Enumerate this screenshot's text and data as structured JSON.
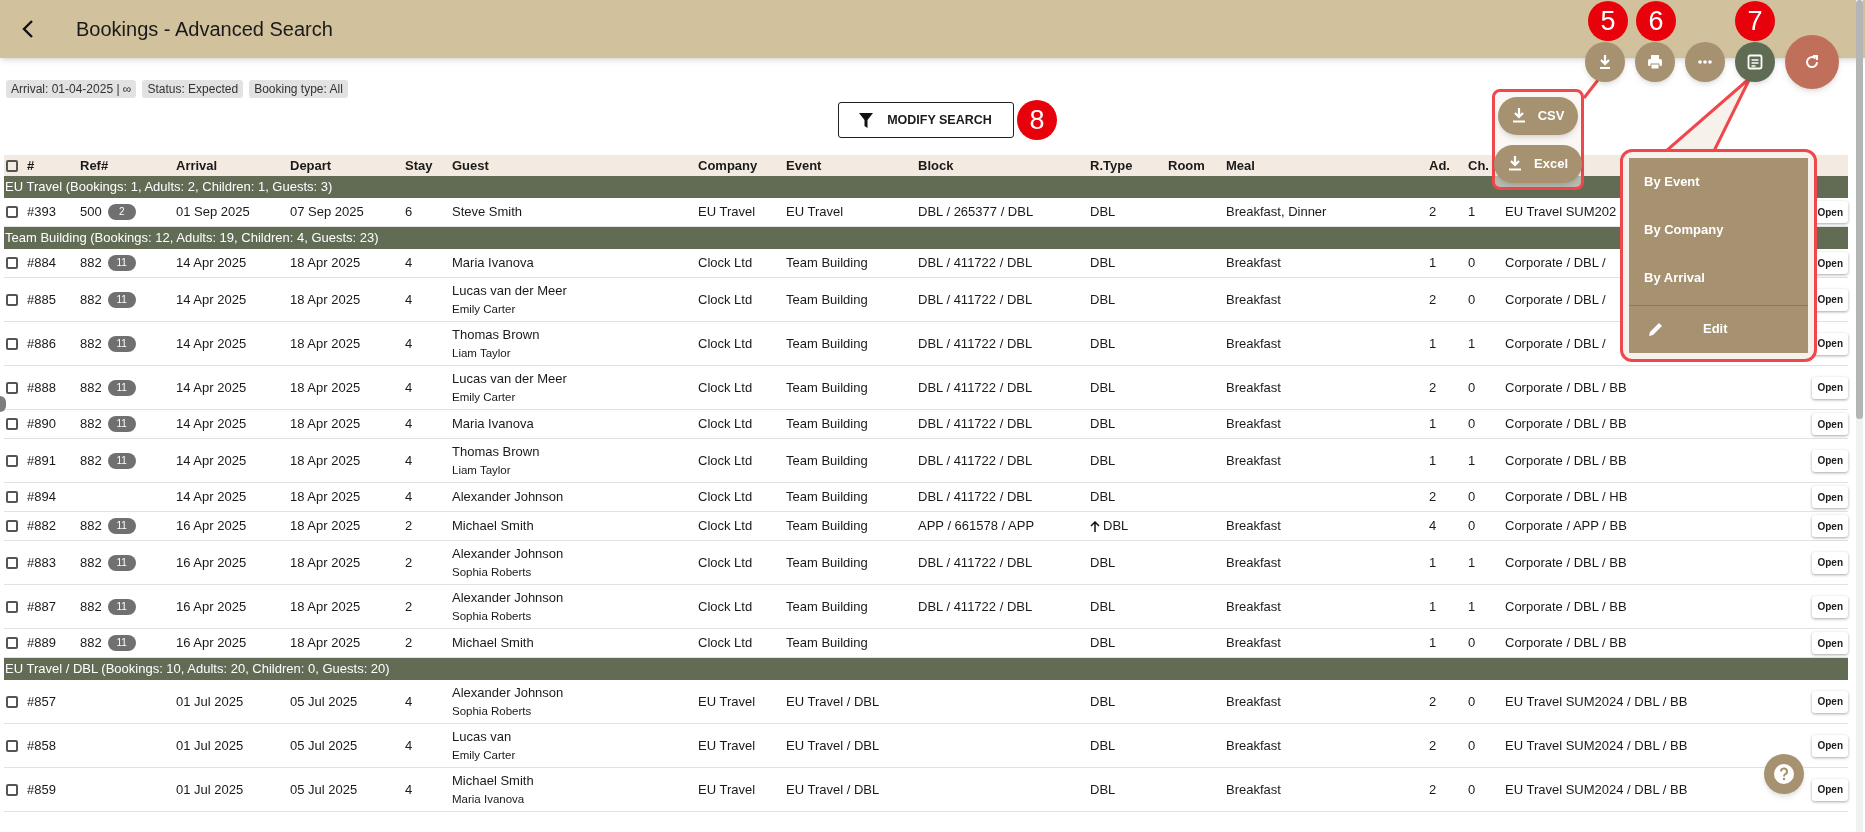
{
  "header": {
    "title": "Bookings - Advanced Search"
  },
  "filters": [
    "Arrival: 01-04-2025 | ∞",
    "Status: Expected",
    "Booking type: All"
  ],
  "modify_search": "MODIFY SEARCH",
  "annotations": [
    "5",
    "6",
    "7",
    "8"
  ],
  "export_menu": [
    "CSV",
    "Excel"
  ],
  "view_menu": {
    "items": [
      "By Event",
      "By Company",
      "By Arrival"
    ],
    "edit": "Edit"
  },
  "table": {
    "select_all_checked": false,
    "columns": [
      "#",
      "Ref#",
      "Arrival",
      "Depart",
      "Stay",
      "Guest",
      "Company",
      "Event",
      "Block",
      "R.Type",
      "Room",
      "Meal",
      "Ad.",
      "Ch."
    ],
    "rows": [
      {
        "kind": "group",
        "text": "EU Travel (Bookings: 1, Adults: 2, Children: 1, Guests: 3)"
      },
      {
        "kind": "booking",
        "checked": false,
        "number": "#393",
        "ref": "500",
        "ref_count": "2",
        "arrival": "01 Sep 2025",
        "depart": "07 Sep 2025",
        "stay": "6",
        "guest": "Steve Smith",
        "company": "EU Travel",
        "event": "EU Travel",
        "block": "DBL / 265377 / DBL",
        "rtype": "DBL",
        "upgraded": false,
        "meal": "Breakfast, Dinner",
        "adults": "2",
        "children": "1",
        "package": "EU Travel SUM202",
        "open": "Open"
      },
      {
        "kind": "group",
        "text": "Team Building (Bookings: 12, Adults: 19, Children: 4, Guests: 23)"
      },
      {
        "kind": "booking",
        "checked": false,
        "number": "#884",
        "ref": "882",
        "ref_count": "11",
        "arrival": "14 Apr 2025",
        "depart": "18 Apr 2025",
        "stay": "4",
        "guest": "Maria Ivanova",
        "company": "Clock Ltd",
        "event": "Team Building",
        "block": "DBL / 411722 / DBL",
        "rtype": "DBL",
        "upgraded": false,
        "meal": "Breakfast",
        "adults": "1",
        "children": "0",
        "package": "Corporate / DBL /",
        "open": "Open"
      },
      {
        "kind": "booking",
        "checked": false,
        "number": "#885",
        "ref": "882",
        "ref_count": "11",
        "arrival": "14 Apr 2025",
        "depart": "18 Apr 2025",
        "stay": "4",
        "guest": "Lucas van der Meer",
        "guest_2": "Emily Carter",
        "company": "Clock Ltd",
        "event": "Team Building",
        "block": "DBL / 411722 / DBL",
        "rtype": "DBL",
        "upgraded": false,
        "meal": "Breakfast",
        "adults": "2",
        "children": "0",
        "package": "Corporate / DBL /",
        "open": "Open"
      },
      {
        "kind": "booking",
        "checked": false,
        "number": "#886",
        "ref": "882",
        "ref_count": "11",
        "arrival": "14 Apr 2025",
        "depart": "18 Apr 2025",
        "stay": "4",
        "guest": "Thomas Brown",
        "guest_2": "Liam Taylor",
        "company": "Clock Ltd",
        "event": "Team Building",
        "block": "DBL / 411722 / DBL",
        "rtype": "DBL",
        "upgraded": false,
        "meal": "Breakfast",
        "adults": "1",
        "children": "1",
        "package": "Corporate / DBL /",
        "open": "Open"
      },
      {
        "kind": "booking",
        "checked": false,
        "number": "#888",
        "ref": "882",
        "ref_count": "11",
        "arrival": "14 Apr 2025",
        "depart": "18 Apr 2025",
        "stay": "4",
        "guest": "Lucas van der Meer",
        "guest_2": "Emily Carter",
        "company": "Clock Ltd",
        "event": "Team Building",
        "block": "DBL / 411722 / DBL",
        "rtype": "DBL",
        "upgraded": false,
        "meal": "Breakfast",
        "adults": "2",
        "children": "0",
        "package": "Corporate / DBL / BB",
        "open": "Open"
      },
      {
        "kind": "booking",
        "checked": false,
        "number": "#890",
        "ref": "882",
        "ref_count": "11",
        "arrival": "14 Apr 2025",
        "depart": "18 Apr 2025",
        "stay": "4",
        "guest": "Maria Ivanova",
        "company": "Clock Ltd",
        "event": "Team Building",
        "block": "DBL / 411722 / DBL",
        "rtype": "DBL",
        "upgraded": false,
        "meal": "Breakfast",
        "adults": "1",
        "children": "0",
        "package": "Corporate / DBL / BB",
        "open": "Open"
      },
      {
        "kind": "booking",
        "checked": false,
        "number": "#891",
        "ref": "882",
        "ref_count": "11",
        "arrival": "14 Apr 2025",
        "depart": "18 Apr 2025",
        "stay": "4",
        "guest": "Thomas Brown",
        "guest_2": "Liam Taylor",
        "company": "Clock Ltd",
        "event": "Team Building",
        "block": "DBL / 411722 / DBL",
        "rtype": "DBL",
        "upgraded": false,
        "meal": "Breakfast",
        "adults": "1",
        "children": "1",
        "package": "Corporate / DBL / BB",
        "open": "Open"
      },
      {
        "kind": "booking",
        "checked": false,
        "number": "#894",
        "arrival": "14 Apr 2025",
        "depart": "18 Apr 2025",
        "stay": "4",
        "guest": "Alexander Johnson",
        "company": "Clock Ltd",
        "event": "Team Building",
        "block": "DBL / 411722 / DBL",
        "rtype": "DBL",
        "upgraded": false,
        "adults": "2",
        "children": "0",
        "package": "Corporate / DBL / HB",
        "open": "Open"
      },
      {
        "kind": "booking",
        "checked": false,
        "number": "#882",
        "ref": "882",
        "ref_count": "11",
        "arrival": "16 Apr 2025",
        "depart": "18 Apr 2025",
        "stay": "2",
        "guest": "Michael Smith",
        "company": "Clock Ltd",
        "event": "Team Building",
        "block": "APP / 661578 / APP",
        "rtype": "DBL",
        "upgraded": true,
        "meal": "Breakfast",
        "adults": "4",
        "children": "0",
        "package": "Corporate / APP / BB",
        "open": "Open"
      },
      {
        "kind": "booking",
        "checked": false,
        "number": "#883",
        "ref": "882",
        "ref_count": "11",
        "arrival": "16 Apr 2025",
        "depart": "18 Apr 2025",
        "stay": "2",
        "guest": "Alexander Johnson",
        "guest_2": "Sophia Roberts",
        "company": "Clock Ltd",
        "event": "Team Building",
        "block": "DBL / 411722 / DBL",
        "rtype": "DBL",
        "upgraded": false,
        "meal": "Breakfast",
        "adults": "1",
        "children": "1",
        "package": "Corporate / DBL / BB",
        "open": "Open"
      },
      {
        "kind": "booking",
        "checked": false,
        "number": "#887",
        "ref": "882",
        "ref_count": "11",
        "arrival": "16 Apr 2025",
        "depart": "18 Apr 2025",
        "stay": "2",
        "guest": "Alexander Johnson",
        "guest_2": "Sophia Roberts",
        "company": "Clock Ltd",
        "event": "Team Building",
        "block": "DBL / 411722 / DBL",
        "rtype": "DBL",
        "upgraded": false,
        "meal": "Breakfast",
        "adults": "1",
        "children": "1",
        "package": "Corporate / DBL / BB",
        "open": "Open"
      },
      {
        "kind": "booking",
        "checked": false,
        "number": "#889",
        "ref": "882",
        "ref_count": "11",
        "arrival": "16 Apr 2025",
        "depart": "18 Apr 2025",
        "stay": "2",
        "guest": "Michael Smith",
        "company": "Clock Ltd",
        "event": "Team Building",
        "rtype": "DBL",
        "upgraded": false,
        "meal": "Breakfast",
        "adults": "1",
        "children": "0",
        "package": "Corporate / DBL / BB",
        "open": "Open"
      },
      {
        "kind": "group",
        "text": "EU Travel / DBL (Bookings: 10, Adults: 20, Children: 0, Guests: 20)"
      },
      {
        "kind": "booking",
        "checked": false,
        "number": "#857",
        "arrival": "01 Jul 2025",
        "depart": "05 Jul 2025",
        "stay": "4",
        "guest": "Alexander Johnson",
        "guest_2": "Sophia Roberts",
        "company": "EU Travel",
        "event": "EU Travel / DBL",
        "rtype": "DBL",
        "upgraded": false,
        "meal": "Breakfast",
        "adults": "2",
        "children": "0",
        "package": "EU Travel SUM2024 / DBL / BB",
        "open": "Open"
      },
      {
        "kind": "booking",
        "checked": false,
        "number": "#858",
        "arrival": "01 Jul 2025",
        "depart": "05 Jul 2025",
        "stay": "4",
        "guest": "Lucas van",
        "guest_2": "Emily Carter",
        "company": "EU Travel",
        "event": "EU Travel / DBL",
        "rtype": "DBL",
        "upgraded": false,
        "meal": "Breakfast",
        "adults": "2",
        "children": "0",
        "package": "EU Travel SUM2024 / DBL / BB",
        "open": "Open"
      },
      {
        "kind": "booking",
        "checked": false,
        "number": "#859",
        "arrival": "01 Jul 2025",
        "depart": "05 Jul 2025",
        "stay": "4",
        "guest": "Michael Smith",
        "guest_2": "Maria Ivanova",
        "company": "EU Travel",
        "event": "EU Travel / DBL",
        "rtype": "DBL",
        "upgraded": false,
        "meal": "Breakfast",
        "adults": "2",
        "children": "0",
        "package": "EU Travel SUM2024 / DBL / BB",
        "open": "Open"
      }
    ]
  }
}
